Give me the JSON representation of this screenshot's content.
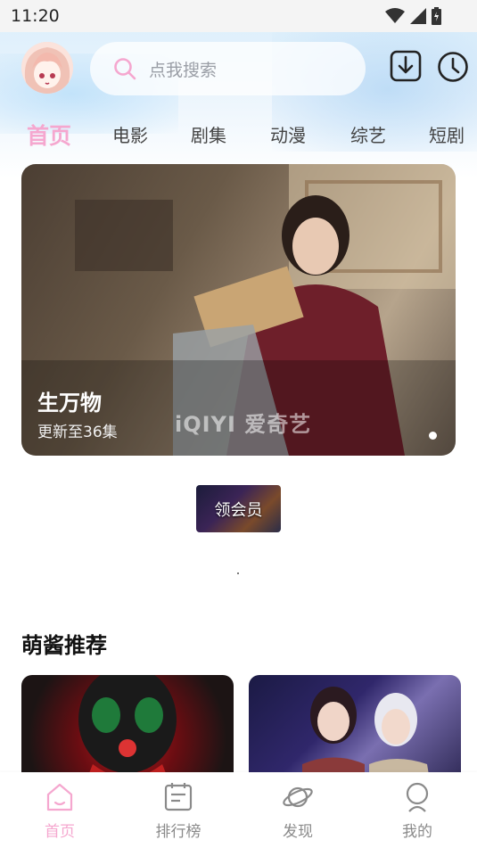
{
  "status_bar": {
    "time": "11:20"
  },
  "header": {
    "search_placeholder": "点我搜索"
  },
  "tabs": [
    {
      "label": "首页",
      "active": true
    },
    {
      "label": "电影",
      "active": false
    },
    {
      "label": "剧集",
      "active": false
    },
    {
      "label": "动漫",
      "active": false
    },
    {
      "label": "综艺",
      "active": false
    },
    {
      "label": "短剧",
      "active": false
    }
  ],
  "banner": {
    "title": "生万物",
    "subtitle": "更新至36集",
    "watermark": "iQIYI 爱奇艺"
  },
  "vip_button": {
    "label": "领会员"
  },
  "recommend": {
    "title": "萌酱推荐"
  },
  "bottom_nav": [
    {
      "label": "首页",
      "icon": "home-icon",
      "active": true
    },
    {
      "label": "排行榜",
      "icon": "ranking-icon",
      "active": false
    },
    {
      "label": "发现",
      "icon": "planet-icon",
      "active": false
    },
    {
      "label": "我的",
      "icon": "profile-icon",
      "active": false
    }
  ],
  "colors": {
    "accent": "#f5a7cf",
    "nav_inactive": "#8a8a8a"
  }
}
